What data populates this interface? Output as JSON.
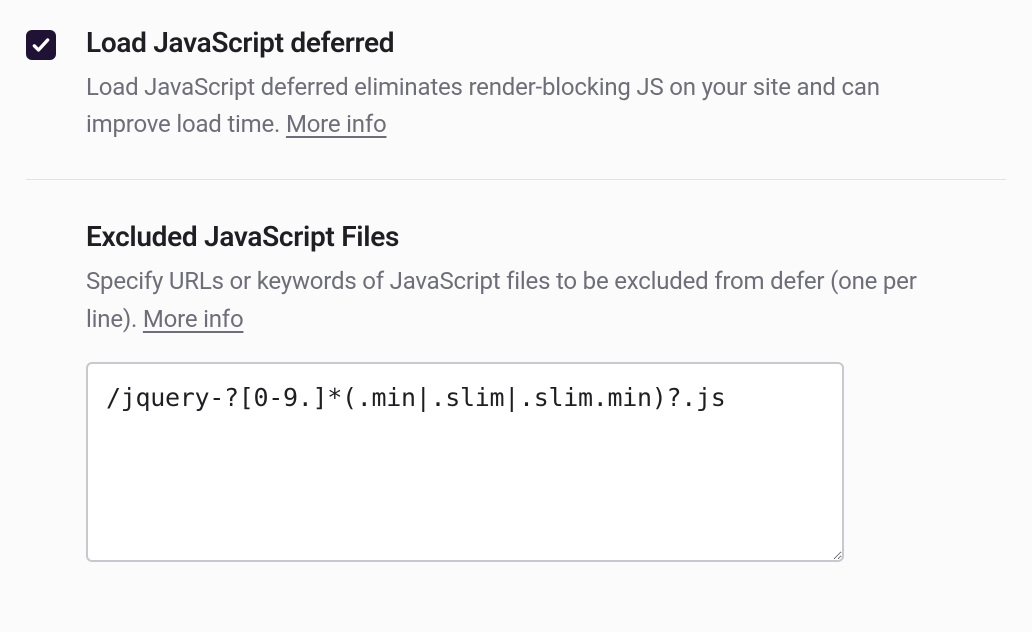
{
  "defer": {
    "checked": true,
    "title": "Load JavaScript deferred",
    "description_prefix": "Load JavaScript deferred eliminates render-blocking JS on your site and can improve load time. ",
    "more_info": "More info"
  },
  "exclude": {
    "title": "Excluded JavaScript Files",
    "description_prefix": "Specify URLs or keywords of JavaScript files to be excluded from defer (one per line). ",
    "more_info": "More info",
    "value": "/jquery-?[0-9.]*(.min|.slim|.slim.min)?.js"
  }
}
